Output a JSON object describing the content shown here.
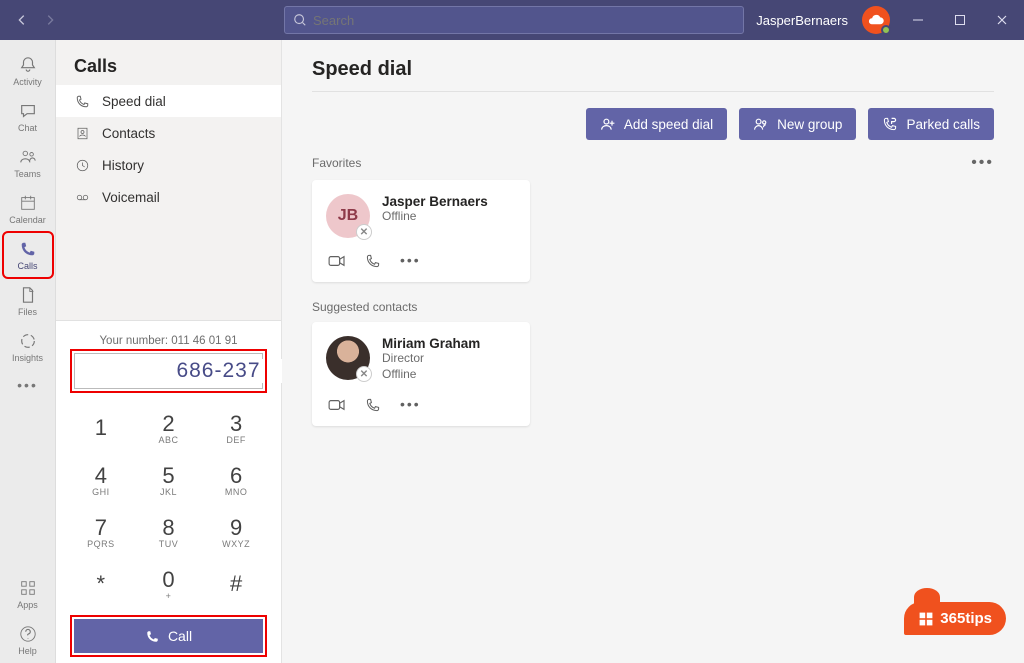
{
  "titlebar": {
    "search_placeholder": "Search",
    "username": "JasperBernaers"
  },
  "rail": {
    "items": [
      {
        "label": "Activity"
      },
      {
        "label": "Chat"
      },
      {
        "label": "Teams"
      },
      {
        "label": "Calendar"
      },
      {
        "label": "Calls"
      },
      {
        "label": "Files"
      },
      {
        "label": "Insights"
      }
    ],
    "apps_label": "Apps",
    "help_label": "Help"
  },
  "col2": {
    "header": "Calls",
    "nav": [
      {
        "label": "Speed dial"
      },
      {
        "label": "Contacts"
      },
      {
        "label": "History"
      },
      {
        "label": "Voicemail"
      }
    ],
    "your_number_label": "Your number: 011 46 01 91",
    "dial_value": "686-237",
    "keys": [
      {
        "d": "1",
        "l": ""
      },
      {
        "d": "2",
        "l": "ABC"
      },
      {
        "d": "3",
        "l": "DEF"
      },
      {
        "d": "4",
        "l": "GHI"
      },
      {
        "d": "5",
        "l": "JKL"
      },
      {
        "d": "6",
        "l": "MNO"
      },
      {
        "d": "7",
        "l": "PQRS"
      },
      {
        "d": "8",
        "l": "TUV"
      },
      {
        "d": "9",
        "l": "WXYZ"
      },
      {
        "d": "*",
        "l": ""
      },
      {
        "d": "0",
        "l": "+"
      },
      {
        "d": "#",
        "l": ""
      }
    ],
    "call_label": "Call"
  },
  "main": {
    "title": "Speed dial",
    "actions": {
      "add": "Add speed dial",
      "newgroup": "New group",
      "parked": "Parked calls"
    },
    "favorites_label": "Favorites",
    "suggested_label": "Suggested contacts",
    "favorites": [
      {
        "initials": "JB",
        "name": "Jasper Bernaers",
        "status": "Offline"
      }
    ],
    "suggested": [
      {
        "name": "Miriam Graham",
        "title": "Director",
        "status": "Offline"
      }
    ]
  },
  "watermark": "365tips"
}
